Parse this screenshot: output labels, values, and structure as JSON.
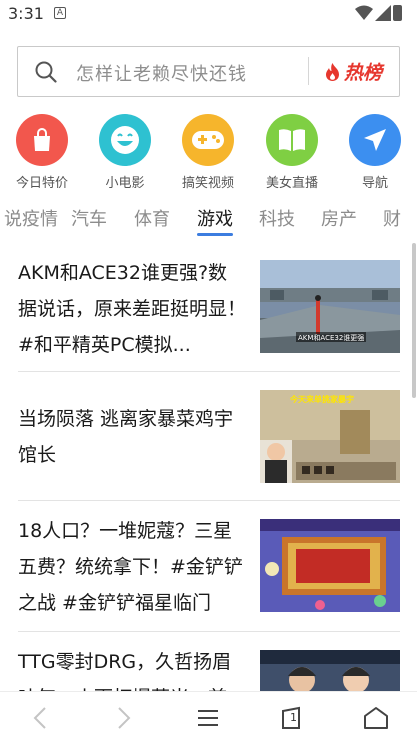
{
  "status_bar": {
    "time": "3:31",
    "notification_glyph": "A"
  },
  "search": {
    "placeholder": "怎样让老赖尽快还钱",
    "hot_label": "热榜"
  },
  "quick_links": [
    {
      "label": "今日特价",
      "icon": "shopping-bag-icon",
      "color": "#f2574d"
    },
    {
      "label": "小电影",
      "icon": "smiley-icon",
      "color": "#2ec1d1"
    },
    {
      "label": "搞笑视频",
      "icon": "gamepad-icon",
      "color": "#f6b52c"
    },
    {
      "label": "美女直播",
      "icon": "book-icon",
      "color": "#7fcf43"
    },
    {
      "label": "导航",
      "icon": "navigation-icon",
      "color": "#3c8ff0"
    }
  ],
  "tabs": [
    {
      "label": "说疫情"
    },
    {
      "label": "汽车"
    },
    {
      "label": "体育"
    },
    {
      "label": "游戏"
    },
    {
      "label": "科技"
    },
    {
      "label": "房产"
    },
    {
      "label": "财"
    }
  ],
  "active_tab": "游戏",
  "articles": [
    {
      "title": "AKM和ACE32谁更强?数据说话，原来差距挺明显！ #和平精英PC模拟...",
      "thumb_caption": "AKM和ACE32谁更强"
    },
    {
      "title": "当场陨落 逃离家暴菜鸡宇馆长",
      "thumb_caption": "今天来单挑家暴宇"
    },
    {
      "title": "18人口？一堆妮蔻？三星五费？统统拿下！#金铲铲之战 #金铲铲福星临门",
      "thumb_caption": ""
    },
    {
      "title": "TTG零封DRG，久哲扬眉吐气，小雨打爆菲米，首...",
      "thumb_caption": ""
    }
  ],
  "bottom_nav": {
    "tabs_count": "1"
  }
}
